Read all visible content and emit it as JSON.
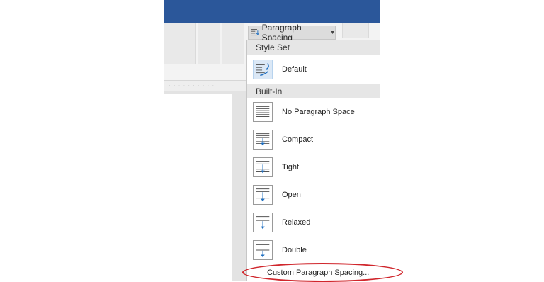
{
  "paragraph_spacing_button": {
    "label": "Paragraph Spacing"
  },
  "menu": {
    "style_set_header": "Style Set",
    "default_item": {
      "label": "Default",
      "icon": "paragraph-spacing-default-icon"
    },
    "built_in_header": "Built-In",
    "built_in_items": [
      {
        "label": "No Paragraph Space",
        "icon": "no-paragraph-space-icon"
      },
      {
        "label": "Compact",
        "icon": "compact-spacing-icon"
      },
      {
        "label": "Tight",
        "icon": "tight-spacing-icon"
      },
      {
        "label": "Open",
        "icon": "open-spacing-icon"
      },
      {
        "label": "Relaxed",
        "icon": "relaxed-spacing-icon"
      },
      {
        "label": "Double",
        "icon": "double-spacing-icon"
      }
    ],
    "custom_item": {
      "label": "Custom  Paragraph Spacing..."
    }
  },
  "colors": {
    "title_bar": "#2b579a",
    "accent_arrow": "#1f6fc1",
    "annotation_oval": "#d0262c"
  }
}
